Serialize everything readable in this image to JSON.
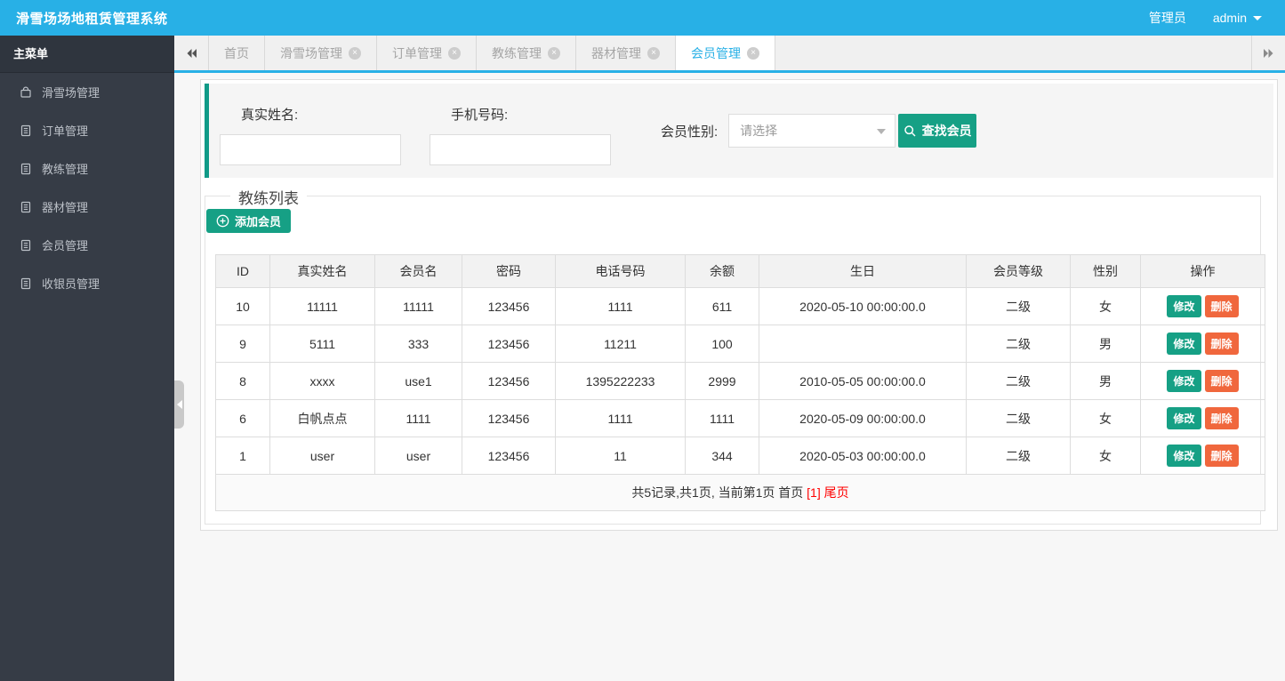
{
  "app": {
    "title": "滑雪场场地租赁管理系统",
    "role_label": "管理员",
    "username": "admin"
  },
  "sidebar": {
    "header": "主菜单",
    "items": [
      {
        "label": "滑雪场管理",
        "icon": "bag-icon"
      },
      {
        "label": "订单管理",
        "icon": "file-icon"
      },
      {
        "label": "教练管理",
        "icon": "file-icon"
      },
      {
        "label": "器材管理",
        "icon": "file-icon"
      },
      {
        "label": "会员管理",
        "icon": "file-icon"
      },
      {
        "label": "收银员管理",
        "icon": "file-icon"
      }
    ]
  },
  "tabs": {
    "items": [
      {
        "label": "首页",
        "closable": false,
        "active": false
      },
      {
        "label": "滑雪场管理",
        "closable": true,
        "active": false
      },
      {
        "label": "订单管理",
        "closable": true,
        "active": false
      },
      {
        "label": "教练管理",
        "closable": true,
        "active": false
      },
      {
        "label": "器材管理",
        "closable": true,
        "active": false
      },
      {
        "label": "会员管理",
        "closable": true,
        "active": true
      }
    ]
  },
  "search": {
    "name_label": "真实姓名:",
    "name_value": "",
    "phone_label": "手机号码:",
    "phone_value": "",
    "gender_label": "会员性别:",
    "gender_placeholder": "请选择",
    "search_button": "查找会员"
  },
  "list": {
    "legend": "教练列表",
    "add_button": "添加会员",
    "table": {
      "headers": [
        "ID",
        "真实姓名",
        "会员名",
        "密码",
        "电话号码",
        "余额",
        "生日",
        "会员等级",
        "性别",
        "操作"
      ],
      "rows": [
        {
          "id": "10",
          "real_name": "11111",
          "member_name": "11111",
          "password": "123456",
          "phone": "1111",
          "balance": "611",
          "birthday": "2020-05-10 00:00:00.0",
          "level": "二级",
          "gender": "女"
        },
        {
          "id": "9",
          "real_name": "5111",
          "member_name": "333",
          "password": "123456",
          "phone": "11211",
          "balance": "100",
          "birthday": "",
          "level": "二级",
          "gender": "男"
        },
        {
          "id": "8",
          "real_name": "xxxx",
          "member_name": "use1",
          "password": "123456",
          "phone": "1395222233",
          "balance": "2999",
          "birthday": "2010-05-05 00:00:00.0",
          "level": "二级",
          "gender": "男"
        },
        {
          "id": "6",
          "real_name": "白帆点点",
          "member_name": "1111",
          "password": "123456",
          "phone": "1111",
          "balance": "1111",
          "birthday": "2020-05-09 00:00:00.0",
          "level": "二级",
          "gender": "女"
        },
        {
          "id": "1",
          "real_name": "user",
          "member_name": "user",
          "password": "123456",
          "phone": "11",
          "balance": "344",
          "birthday": "2020-05-03 00:00:00.0",
          "level": "二级",
          "gender": "女"
        }
      ],
      "actions": {
        "edit": "修改",
        "delete": "删除"
      }
    },
    "pagination": {
      "summary": "共5记录,共1页, 当前第1页",
      "first": "首页",
      "current": "[1]",
      "last": "尾页"
    }
  },
  "icons": [
    "bag-icon",
    "file-icon",
    "close-icon",
    "double-left-arrow-icon",
    "double-right-arrow-icon",
    "magnifier-icon",
    "plus-circle-icon",
    "caret-down-icon",
    "left-triangle-icon"
  ],
  "colors": {
    "topbar_blue": "#28b0e6",
    "sidebar_dark": "#363c46",
    "accent_teal": "#16a085",
    "danger_orange": "#f0673d",
    "pagination_red": "#ff0000"
  }
}
